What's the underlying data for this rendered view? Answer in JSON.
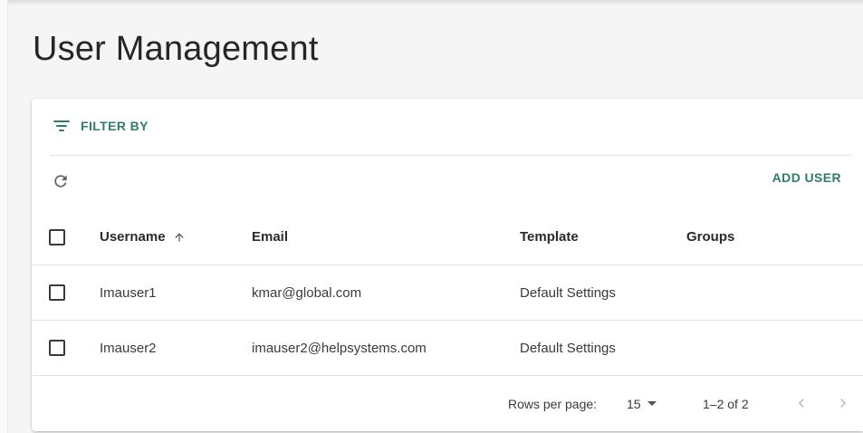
{
  "page": {
    "title": "User Management"
  },
  "filter": {
    "label": "FILTER BY",
    "icon": "filter-list-icon"
  },
  "toolbar": {
    "refresh_icon": "refresh-icon",
    "add_user_label": "ADD USER"
  },
  "table": {
    "columns": {
      "username": "Username",
      "email": "Email",
      "template": "Template",
      "groups": "Groups"
    },
    "sort": {
      "column": "username",
      "direction": "ascending",
      "icon": "arrow-up-icon"
    },
    "rows": [
      {
        "username": "Imauser1",
        "email": "kmar@global.com",
        "template": "Default Settings",
        "groups": ""
      },
      {
        "username": "Imauser2",
        "email": "imauser2@helpsystems.com",
        "template": "Default Settings",
        "groups": ""
      }
    ]
  },
  "pagination": {
    "rows_per_page_label": "Rows per page:",
    "rows_per_page_value": "15",
    "range": "1–2 of 2",
    "prev_icon": "chevron-left-icon",
    "next_icon": "chevron-right-icon"
  },
  "colors": {
    "accent": "#2e7d6b",
    "text": "#212121",
    "divider": "#e0e0e0",
    "background": "#f5f5f5"
  }
}
